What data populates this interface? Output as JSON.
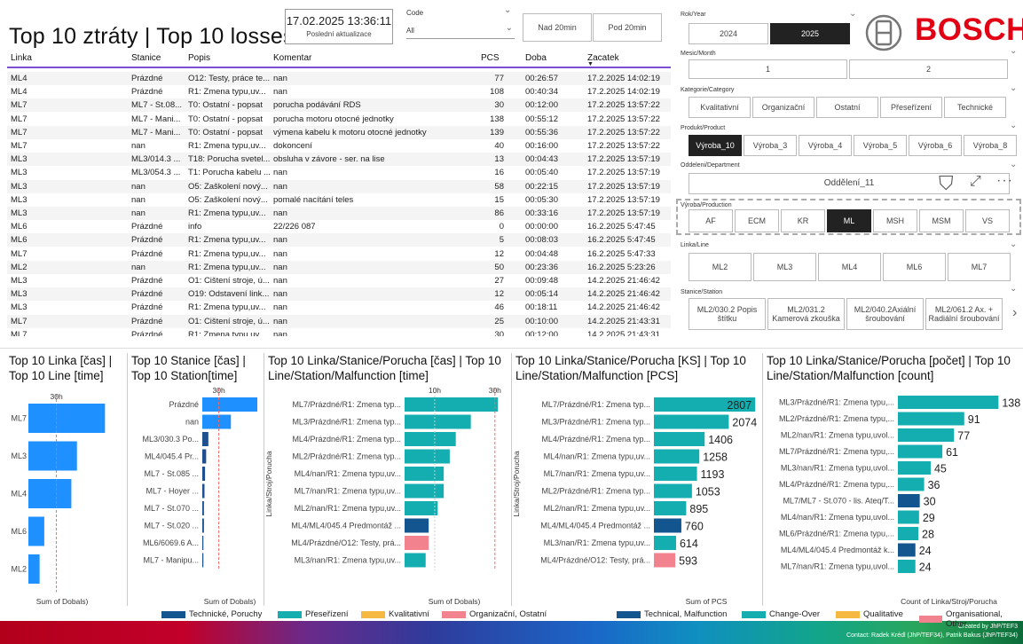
{
  "header": {
    "title": "Top 10 ztráty | Top 10 losses",
    "last_update_value": "17.02.2025 13:36:11",
    "last_update_label": "Poslední aktualizace",
    "code_label": "Code",
    "code_value": "All",
    "btn_over": "Nad 20min",
    "btn_under": "Pod 20min"
  },
  "brand": {
    "logo": "BOSCH",
    "color": "#e20015"
  },
  "filters": {
    "year": {
      "label": "Rok/Year",
      "options": [
        "2024",
        "2025"
      ],
      "selected": "2025"
    },
    "month": {
      "label": "Mesic/Month",
      "options": [
        "1",
        "2"
      ]
    },
    "category": {
      "label": "Kategorie/Category",
      "options": [
        "Kvalitativní",
        "Organizační",
        "Ostatní",
        "Přeseřízení",
        "Technické"
      ]
    },
    "product": {
      "label": "Produkt/Product",
      "options": [
        "Výroba_10",
        "Výroba_3",
        "Výroba_4",
        "Výroba_5",
        "Výroba_6",
        "Výroba_8"
      ],
      "selected": "Výroba_10"
    },
    "department": {
      "label": "Oddeleni/Department",
      "value": "Oddělení_11"
    },
    "production": {
      "label": "Výroba/Production",
      "options": [
        "AF",
        "ECM",
        "KR",
        "ML",
        "MSH",
        "MSM",
        "VS"
      ],
      "selected": "ML"
    },
    "line": {
      "label": "Linka/Line",
      "options": [
        "ML2",
        "ML3",
        "ML4",
        "ML6",
        "ML7"
      ]
    },
    "station": {
      "label": "Stanice/Station",
      "options": [
        "ML2/030.2 Popis štítku",
        "ML2/031.2 Kamerová zkouška",
        "ML2/040.2Axiální šroubování",
        "ML2/061.2 Ax. + Radiální šroubování"
      ]
    }
  },
  "table": {
    "headers": [
      "Linka",
      "Stanice",
      "Popis",
      "Komentar",
      "PCS",
      "Doba",
      "Zacatek"
    ],
    "rows": [
      [
        "ML4",
        "Prázdné",
        "O12: Testy, práce te...",
        "nan",
        "77",
        "00:26:57",
        "17.2.2025 14:02:19"
      ],
      [
        "ML4",
        "Prázdné",
        "R1: Zmena typu,uv...",
        "nan",
        "108",
        "00:40:34",
        "17.2.2025 14:02:19"
      ],
      [
        "ML7",
        "ML7 - St.08...",
        "T0: Ostatní - popsat",
        "porucha podávání RDS",
        "30",
        "00:12:00",
        "17.2.2025 13:57:22"
      ],
      [
        "ML7",
        "ML7 - Mani...",
        "T0: Ostatní - popsat",
        "porucha motoru otocné jednotky",
        "138",
        "00:55:12",
        "17.2.2025 13:57:22"
      ],
      [
        "ML7",
        "ML7 - Mani...",
        "T0: Ostatní - popsat",
        "výmena kabelu k motoru otocné jednotky",
        "139",
        "00:55:36",
        "17.2.2025 13:57:22"
      ],
      [
        "ML7",
        "nan",
        "R1: Zmena typu,uv...",
        "dokoncení",
        "40",
        "00:16:00",
        "17.2.2025 13:57:22"
      ],
      [
        "ML3",
        "ML3/014.3 ...",
        "T18: Porucha svetel...",
        "obsluha v závore - ser. na lise",
        "13",
        "00:04:43",
        "17.2.2025 13:57:19"
      ],
      [
        "ML3",
        "ML3/054.3 ...",
        "T1: Porucha kabelu ...",
        "nan",
        "16",
        "00:05:40",
        "17.2.2025 13:57:19"
      ],
      [
        "ML3",
        "nan",
        "O5: Zaškolení nový...",
        "nan",
        "58",
        "00:22:15",
        "17.2.2025 13:57:19"
      ],
      [
        "ML3",
        "nan",
        "O5: Zaškolení nový...",
        "pomalé nacítání teles",
        "15",
        "00:05:30",
        "17.2.2025 13:57:19"
      ],
      [
        "ML3",
        "nan",
        "R1: Zmena typu,uv...",
        "nan",
        "86",
        "00:33:16",
        "17.2.2025 13:57:19"
      ],
      [
        "ML6",
        "Prázdné",
        "info",
        "22/226 087",
        "0",
        "00:00:00",
        "16.2.2025 5:47:45"
      ],
      [
        "ML6",
        "Prázdné",
        "R1: Zmena typu,uv...",
        "nan",
        "5",
        "00:08:03",
        "16.2.2025 5:47:45"
      ],
      [
        "ML7",
        "Prázdné",
        "R1: Zmena typu,uv...",
        "nan",
        "12",
        "00:04:48",
        "16.2.2025 5:47:33"
      ],
      [
        "ML2",
        "nan",
        "R1: Zmena typu,uv...",
        "nan",
        "50",
        "00:23:36",
        "16.2.2025 5:23:26"
      ],
      [
        "ML3",
        "Prázdné",
        "O1: Cištení stroje, ú...",
        "nan",
        "27",
        "00:09:48",
        "14.2.2025 21:46:42"
      ],
      [
        "ML3",
        "Prázdné",
        "O19: Odstavení link...",
        "nan",
        "12",
        "00:05:14",
        "14.2.2025 21:46:42"
      ],
      [
        "ML3",
        "Prázdné",
        "R1: Zmena typu,uv...",
        "nan",
        "46",
        "00:18:11",
        "14.2.2025 21:46:42"
      ],
      [
        "ML7",
        "Prázdné",
        "O1: Cištení stroje, ú...",
        "nan",
        "25",
        "00:10:00",
        "14.2.2025 21:43:31"
      ],
      [
        "ML7",
        "Prázdné",
        "R1: Zmena typu,uv...",
        "nan",
        "30",
        "00:12:00",
        "14.2.2025 21:43:31"
      ]
    ]
  },
  "legend": {
    "cz": [
      {
        "label": "Technické, Poruchy",
        "color": "#12558f"
      },
      {
        "label": "Přeseřízení",
        "color": "#14aeb0"
      },
      {
        "label": "Kvalitativní",
        "color": "#f5b942"
      },
      {
        "label": "Organizační, Ostatní",
        "color": "#f2828e"
      }
    ],
    "en": [
      {
        "label": "Technical, Malfunction",
        "color": "#12558f"
      },
      {
        "label": "Change-Over",
        "color": "#14aeb0"
      },
      {
        "label": "Qualitative",
        "color": "#f5b942"
      },
      {
        "label": "Organisational, Other",
        "color": "#f2828e"
      }
    ]
  },
  "footer": {
    "created": "Created by JhP/TEF3",
    "contact": "Contact: Radek Krédl (JhP/TEF34), Patrik Bakus (JhP/TEF34)"
  },
  "chart_data": [
    {
      "type": "bar",
      "orientation": "horizontal",
      "title": "Top 10 Linka [čas] | Top 10 Line [time]",
      "xlabel": "Sum of Dobals)",
      "reference_line": "30h",
      "reference_value": 30,
      "categories": [
        "ML7",
        "ML3",
        "ML4",
        "ML6",
        "ML2"
      ],
      "values": [
        82,
        52,
        46,
        17,
        12
      ],
      "colors": [
        "#1e90ff",
        "#1e90ff",
        "#1e90ff",
        "#1e90ff",
        "#1e90ff"
      ],
      "xmax": 95
    },
    {
      "type": "bar",
      "orientation": "horizontal",
      "title": "Top 10 Stanice [čas] | Top 10 Station[time]",
      "xlabel": "Sum of Dobals)",
      "reference_line": "30h",
      "reference_value": 30,
      "categories": [
        "Prázdné",
        "nan",
        "ML3/030.3 Po...",
        "ML4/045.4 Pr...",
        "ML7 - St.085 ...",
        "ML7 - Hoyer ...",
        "ML7 - St.070 ...",
        "ML7 - St.020 ...",
        "ML6/6069.6 A...",
        "ML7 - Manipu..."
      ],
      "values": [
        100,
        52,
        11,
        7,
        5,
        4,
        3,
        3,
        2,
        2
      ],
      "colors": [
        "#1e90ff",
        "#1e90ff",
        "#1e4f8f",
        "#1e4f8f",
        "#1e4f8f",
        "#1e4f8f",
        "#1e4f8f",
        "#1e4f8f",
        "#1e4f8f",
        "#1e4f8f"
      ],
      "xmax": 100
    },
    {
      "type": "bar",
      "orientation": "horizontal",
      "title": "Top 10 Linka/Stanice/Porucha [čas] | Top 10 Line/Station/Malfunction [time]",
      "ylabel": "Linka/Stroj/Porucha",
      "xlabel": "Sum of Dobals)",
      "reference_line": "30h",
      "reference_value": 30,
      "tick_labels": [
        "10h",
        "30h"
      ],
      "tick_values": [
        10,
        30
      ],
      "categories": [
        "ML7/Prázdné/R1: Zmena typ...",
        "ML3/Prázdné/R1: Zmena typ...",
        "ML4/Prázdné/R1: Zmena typ...",
        "ML2/Prázdné/R1: Zmena typ...",
        "ML4/nan/R1: Zmena typu,uv...",
        "ML7/nan/R1: Zmena typu,uv...",
        "ML2/nan/R1: Zmena typu,uv...",
        "ML4/ML4/045.4 Predmontáž ...",
        "ML4/Prázdné/O12: Testy, prá...",
        "ML3/nan/R1: Zmena typu,uv..."
      ],
      "values": [
        31,
        22,
        17,
        15,
        13,
        13,
        11,
        8,
        8,
        7
      ],
      "colors": [
        "#14aeb0",
        "#14aeb0",
        "#14aeb0",
        "#14aeb0",
        "#14aeb0",
        "#14aeb0",
        "#14aeb0",
        "#12558f",
        "#f2828e",
        "#14aeb0"
      ],
      "xmax": 33
    },
    {
      "type": "bar",
      "orientation": "horizontal",
      "title": "Top 10 Linka/Stanice/Porucha [KS] | Top 10 Line/Station/Malfunction [PCS]",
      "ylabel": "Linka/Stroj/Porucha",
      "xlabel": "Sum of PCS",
      "categories": [
        "ML7/Prázdné/R1: Zmena typ...",
        "ML3/Prázdné/R1: Zmena typ...",
        "ML4/Prázdné/R1: Zmena typ...",
        "ML4/nan/R1: Zmena typu,uv...",
        "ML7/nan/R1: Zmena typu,uv...",
        "ML2/Prázdné/R1: Zmena typ...",
        "ML2/nan/R1: Zmena typu,uv...",
        "ML4/ML4/045.4 Predmontáž ...",
        "ML3/nan/R1: Zmena typu,uv...",
        "ML4/Prázdné/O12: Testy, prá..."
      ],
      "values": [
        2807,
        2074,
        1406,
        1258,
        1193,
        1053,
        895,
        760,
        614,
        593
      ],
      "colors": [
        "#14aeb0",
        "#14aeb0",
        "#14aeb0",
        "#14aeb0",
        "#14aeb0",
        "#14aeb0",
        "#14aeb0",
        "#12558f",
        "#14aeb0",
        "#f2828e"
      ],
      "xmax": 2900
    },
    {
      "type": "bar",
      "orientation": "horizontal",
      "title": "Top 10 Linka/Stanice/Porucha [počet] | Top 10 Line/Station/Malfunction [count]",
      "xlabel": "Count of Linka/Stroj/Porucha",
      "categories": [
        "ML3/Prázdné/R1: Zmena typu,...",
        "ML2/Prázdné/R1: Zmena typu,...",
        "ML2/nan/R1: Zmena typu,uvol...",
        "ML7/Prázdné/R1: Zmena typu,...",
        "ML3/nan/R1: Zmena typu,uvol...",
        "ML4/Prázdné/R1: Zmena typu,...",
        "ML7/ML7 - St.070 - lis. Ateq/T...",
        "ML4/nan/R1: Zmena typu,uvol...",
        "ML6/Prázdné/R1: Zmena typu,...",
        "ML4/ML4/045.4 Predmontáž k...",
        "ML7/nan/R1: Zmena typu,uvol..."
      ],
      "values": [
        138,
        91,
        77,
        61,
        45,
        36,
        30,
        29,
        28,
        24,
        24
      ],
      "colors": [
        "#14aeb0",
        "#14aeb0",
        "#14aeb0",
        "#14aeb0",
        "#14aeb0",
        "#14aeb0",
        "#12558f",
        "#14aeb0",
        "#14aeb0",
        "#12558f",
        "#14aeb0"
      ],
      "xmax": 140
    }
  ]
}
